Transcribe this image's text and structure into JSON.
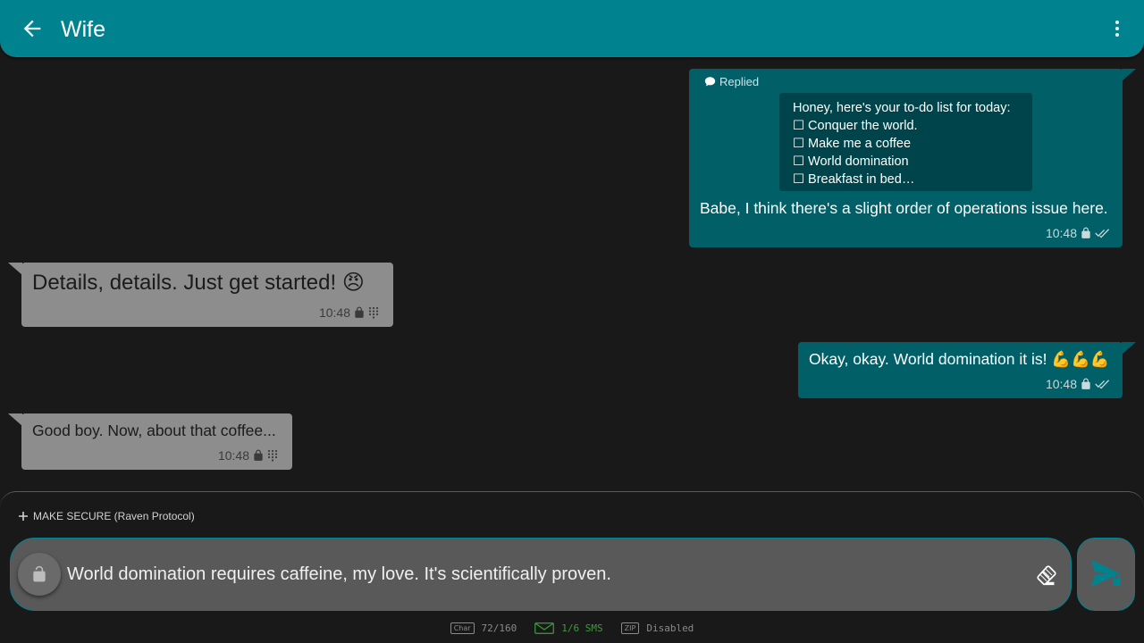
{
  "header": {
    "title": "Wife",
    "back_icon": "arrow-left-icon",
    "menu_icon": "more-vert-icon",
    "color": "#00838f"
  },
  "messages": [
    {
      "direction": "sent",
      "replied_label": "Replied",
      "quote_lines": [
        "Honey, here's your to-do list for today:",
        "☐ Conquer the world.",
        "☐ Make me a coffee",
        "☐ World domination",
        "☐ Breakfast in bed…"
      ],
      "text": "Babe, I think there's a slight order of operations issue here.",
      "time": "10:48",
      "status_icon": "double-check-icon"
    },
    {
      "direction": "received",
      "text": "Details, details. Just get started! 😠",
      "time": "10:48",
      "status_icon": "dialpad-icon"
    },
    {
      "direction": "sent",
      "text": "Okay, okay. World domination it is! 💪💪💪",
      "time": "10:48",
      "status_icon": "double-check-icon"
    },
    {
      "direction": "received",
      "text": "Good boy. Now, about that coffee...",
      "time": "10:48",
      "status_icon": "dialpad-icon"
    }
  ],
  "composer": {
    "make_secure_label": "MAKE SECURE (Raven Protocol)",
    "input_value": "World domination requires caffeine, my love. It's scientifically proven.",
    "status": {
      "char_badge": "Char",
      "char_count": "72/160",
      "sms_count": "1/6 SMS",
      "zip_badge": "ZIP",
      "zip_status": "Disabled"
    }
  },
  "colors": {
    "sent_bubble": "#005f67",
    "received_bubble": "#8d8d8d",
    "background": "#191919",
    "accent": "#00838f",
    "sms_green": "#3e9a3e"
  }
}
